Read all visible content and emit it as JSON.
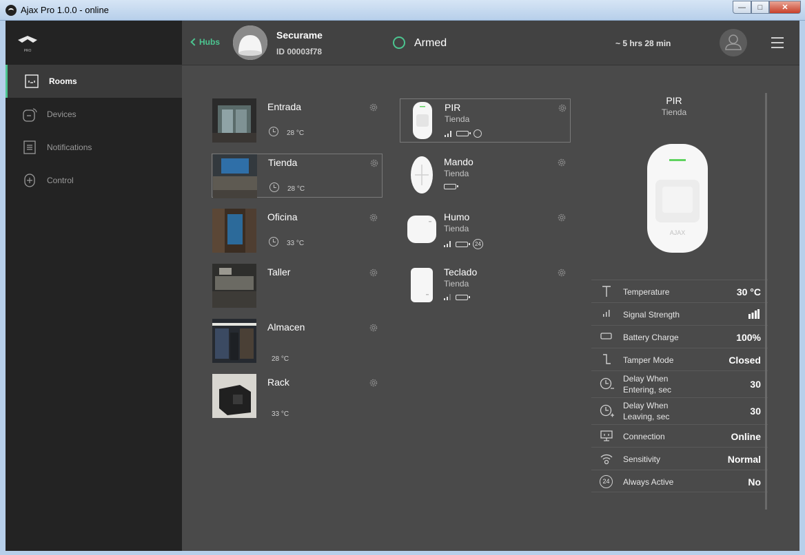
{
  "window": {
    "title": "Ajax Pro 1.0.0 - online",
    "min": "—",
    "max": "□",
    "close": "✕"
  },
  "sidebar": {
    "logo_text": "PRO",
    "items": [
      {
        "label": "Rooms",
        "icon": "rooms-icon",
        "active": true
      },
      {
        "label": "Devices",
        "icon": "devices-icon",
        "active": false
      },
      {
        "label": "Notifications",
        "icon": "notifications-icon",
        "active": false
      },
      {
        "label": "Control",
        "icon": "control-icon",
        "active": false
      }
    ]
  },
  "header": {
    "back_label": "Hubs",
    "hub_name": "Securame",
    "hub_id": "ID 00003f78",
    "status": "Armed",
    "uptime": "~ 5 hrs 28 min"
  },
  "rooms": [
    {
      "name": "Entrada",
      "temp": "28 °C",
      "selected": false
    },
    {
      "name": "Tienda",
      "temp": "28 °C",
      "selected": true
    },
    {
      "name": "Oficina",
      "temp": "33 °C",
      "selected": false
    },
    {
      "name": "Taller",
      "temp": "",
      "selected": false
    },
    {
      "name": "Almacen",
      "temp": "28 °C",
      "selected": false
    },
    {
      "name": "Rack",
      "temp": "33 °C",
      "selected": false
    }
  ],
  "devices": [
    {
      "name": "PIR",
      "room": "Tienda",
      "selected": true
    },
    {
      "name": "Mando",
      "room": "Tienda",
      "selected": false
    },
    {
      "name": "Humo",
      "room": "Tienda",
      "selected": false,
      "always": "24"
    },
    {
      "name": "Teclado",
      "room": "Tienda",
      "selected": false
    }
  ],
  "detail": {
    "title": "PIR",
    "subtitle": "Tienda",
    "brand": "AJAX",
    "properties": [
      {
        "label": "Temperature",
        "value": "30 °C"
      },
      {
        "label": "Signal Strength",
        "value": ""
      },
      {
        "label": "Battery Charge",
        "value": "100%"
      },
      {
        "label": "Tamper Mode",
        "value": "Closed"
      },
      {
        "label": "Delay When Entering, sec",
        "label1": "Delay When",
        "label2": "Entering, sec",
        "value": "30"
      },
      {
        "label": "Delay When Leaving, sec",
        "label1": "Delay When",
        "label2": "Leaving, sec",
        "value": "30"
      },
      {
        "label": "Connection",
        "value": "Online"
      },
      {
        "label": "Sensitivity",
        "value": "Normal"
      },
      {
        "label": "Always Active",
        "value": "No",
        "icon_text": "24"
      }
    ]
  },
  "colors": {
    "accent": "#4cc590",
    "sidebar": "#232323",
    "content": "#4a4a4a",
    "header": "#424242"
  }
}
